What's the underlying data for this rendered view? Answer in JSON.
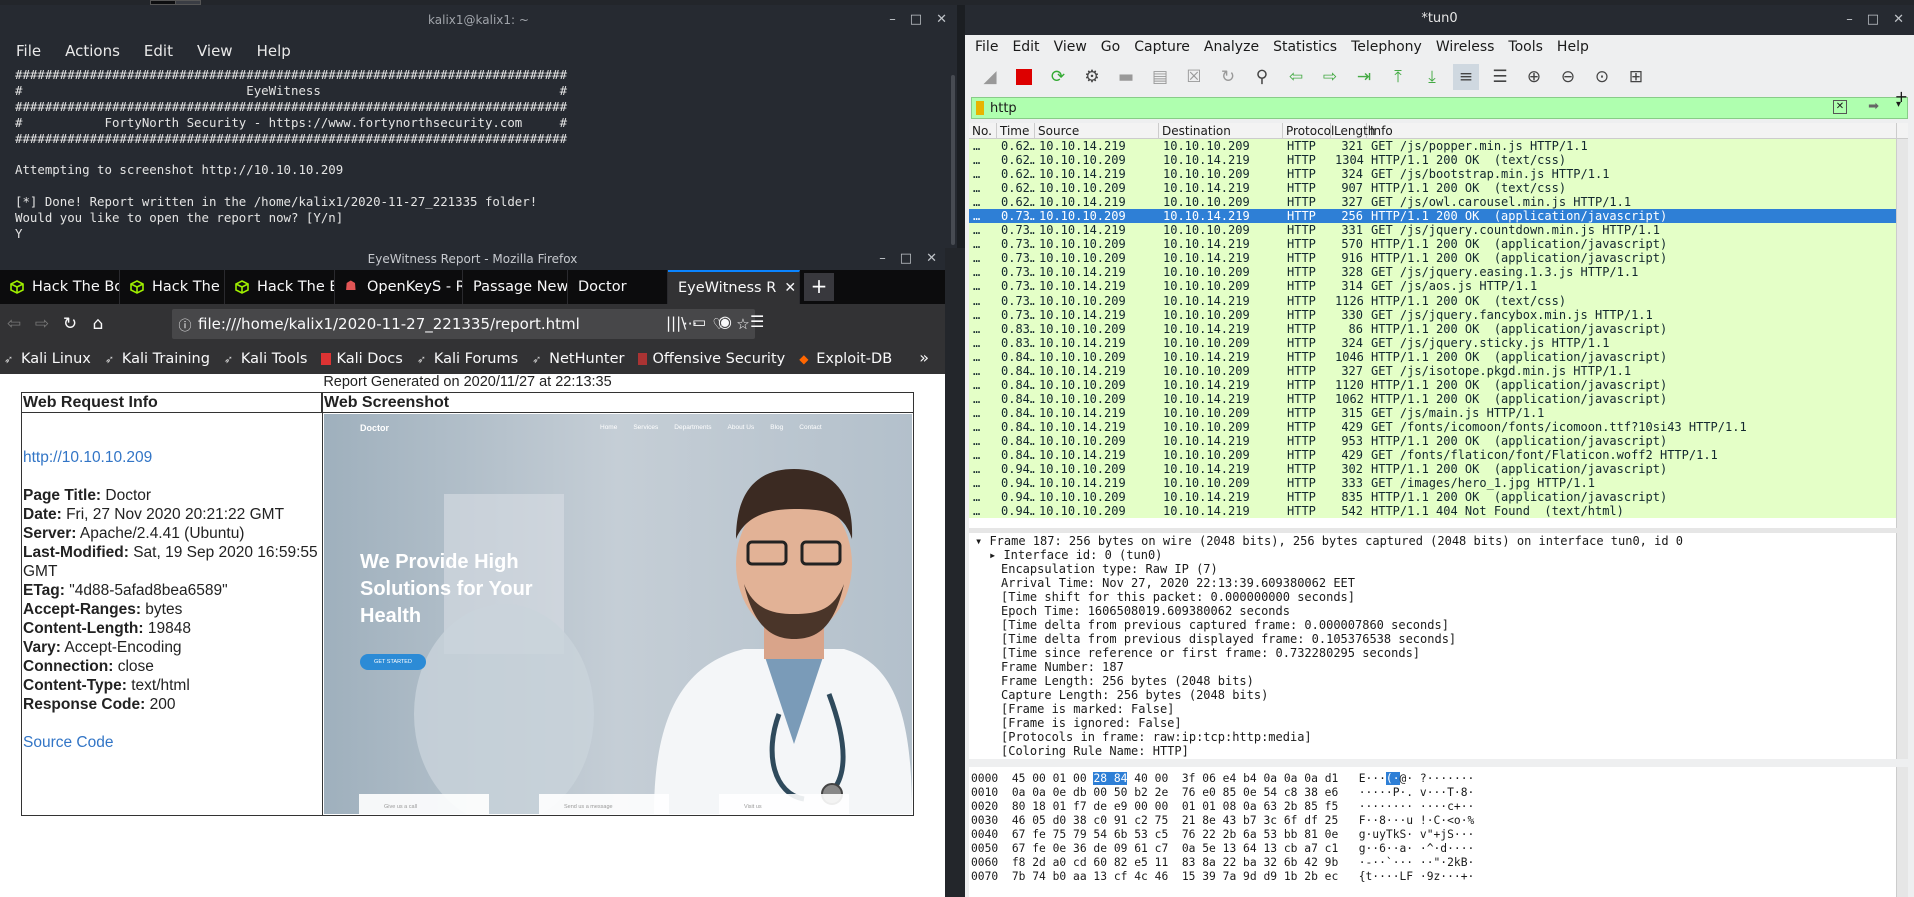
{
  "terminal": {
    "title": "kalix1@kalix1: ~",
    "menu": [
      "File",
      "Actions",
      "Edit",
      "View",
      "Help"
    ],
    "lines": [
      "##########################################################################",
      "#                              EyeWitness                                #",
      "##########################################################################",
      "#           FortyNorth Security - https://www.fortynorthsecurity.com     #",
      "##########################################################################",
      "",
      "Attempting to screenshot http://10.10.10.209",
      "",
      "[*] Done! Report written in the /home/kalix1/2020-11-27_221335 folder!",
      "Would you like to open the report now? [Y/n]",
      "Y"
    ]
  },
  "firefox": {
    "title": "EyeWitness Report - Mozilla Firefox",
    "tabs": [
      {
        "label": "Hack The Box",
        "icon": "htb-cube-icon"
      },
      {
        "label": "Hack The Box",
        "icon": "htb-cube-icon"
      },
      {
        "label": "Hack The Box",
        "icon": "htb-cube-icon"
      },
      {
        "label": "OpenKeyS - R",
        "icon": "bug-icon"
      },
      {
        "label": "Passage News",
        "icon": "none"
      },
      {
        "label": "Doctor",
        "icon": "none"
      },
      {
        "label": "EyeWitness R",
        "icon": "none"
      }
    ],
    "url": "file:///home/kalix1/2020-11-27_221335/report.html",
    "bookmarks": [
      "Kali Linux",
      "Kali Training",
      "Kali Tools",
      "Kali Docs",
      "Kali Forums",
      "NetHunter",
      "Offensive Security",
      "Exploit-DB"
    ]
  },
  "report": {
    "generated": "Report Generated on 2020/11/27 at 22:13:35",
    "col1": "Web Request Info",
    "col2": "Web Screenshot",
    "url": "http://10.10.10.209",
    "fields": [
      {
        "k": "Page Title:",
        "v": " Doctor"
      },
      {
        "k": "Date:",
        "v": " Fri, 27 Nov 2020 20:21:22 GMT"
      },
      {
        "k": "Server:",
        "v": " Apache/2.4.41 (Ubuntu)"
      },
      {
        "k": "Last-Modified:",
        "v": " Sat, 19 Sep 2020 16:59:55 GMT"
      },
      {
        "k": "ETag:",
        "v": " \"4d88-5afad8bea6589\""
      },
      {
        "k": "Accept-Ranges:",
        "v": " bytes"
      },
      {
        "k": "Content-Length:",
        "v": " 19848"
      },
      {
        "k": "Vary:",
        "v": " Accept-Encoding"
      },
      {
        "k": "Connection:",
        "v": " close"
      },
      {
        "k": "Content-Type:",
        "v": " text/html"
      },
      {
        "k": "Response Code:",
        "v": " 200"
      }
    ],
    "source_link": "Source Code",
    "screenshot": {
      "brand": "Doctor",
      "nav": [
        "Home",
        "Services",
        "Departments",
        "About Us",
        "Blog",
        "Contact"
      ],
      "headline": "We Provide High Solutions for Your Health",
      "cta": "GET STARTED",
      "cards": [
        "Give us a call",
        "Send us a message",
        "Visit us"
      ]
    }
  },
  "wireshark": {
    "title": "*tun0",
    "menu": [
      "File",
      "Edit",
      "View",
      "Go",
      "Capture",
      "Analyze",
      "Statistics",
      "Telephony",
      "Wireless",
      "Tools",
      "Help"
    ],
    "filter": "http",
    "columns": [
      "No.",
      "Time",
      "Source",
      "Destination",
      "Protocol",
      "Length",
      "Info"
    ],
    "packets": [
      [
        "…",
        "0.62…",
        "10.10.14.219",
        "10.10.10.209",
        "HTTP",
        "321",
        "GET /js/popper.min.js HTTP/1.1"
      ],
      [
        "…",
        "0.62…",
        "10.10.10.209",
        "10.10.14.219",
        "HTTP",
        "1304",
        "HTTP/1.1 200 OK  (text/css)"
      ],
      [
        "…",
        "0.62…",
        "10.10.14.219",
        "10.10.10.209",
        "HTTP",
        "324",
        "GET /js/bootstrap.min.js HTTP/1.1"
      ],
      [
        "…",
        "0.62…",
        "10.10.10.209",
        "10.10.14.219",
        "HTTP",
        "907",
        "HTTP/1.1 200 OK  (text/css)"
      ],
      [
        "…",
        "0.62…",
        "10.10.14.219",
        "10.10.10.209",
        "HTTP",
        "327",
        "GET /js/owl.carousel.min.js HTTP/1.1"
      ],
      [
        "…",
        "0.73…",
        "10.10.10.209",
        "10.10.14.219",
        "HTTP",
        "256",
        "HTTP/1.1 200 OK  (application/javascript)"
      ],
      [
        "…",
        "0.73…",
        "10.10.14.219",
        "10.10.10.209",
        "HTTP",
        "331",
        "GET /js/jquery.countdown.min.js HTTP/1.1"
      ],
      [
        "…",
        "0.73…",
        "10.10.10.209",
        "10.10.14.219",
        "HTTP",
        "570",
        "HTTP/1.1 200 OK  (application/javascript)"
      ],
      [
        "…",
        "0.73…",
        "10.10.10.209",
        "10.10.14.219",
        "HTTP",
        "916",
        "HTTP/1.1 200 OK  (application/javascript)"
      ],
      [
        "…",
        "0.73…",
        "10.10.14.219",
        "10.10.10.209",
        "HTTP",
        "328",
        "GET /js/jquery.easing.1.3.js HTTP/1.1"
      ],
      [
        "…",
        "0.73…",
        "10.10.14.219",
        "10.10.10.209",
        "HTTP",
        "314",
        "GET /js/aos.js HTTP/1.1"
      ],
      [
        "…",
        "0.73…",
        "10.10.10.209",
        "10.10.14.219",
        "HTTP",
        "1126",
        "HTTP/1.1 200 OK  (text/css)"
      ],
      [
        "…",
        "0.73…",
        "10.10.14.219",
        "10.10.10.209",
        "HTTP",
        "330",
        "GET /js/jquery.fancybox.min.js HTTP/1.1"
      ],
      [
        "…",
        "0.83…",
        "10.10.10.209",
        "10.10.14.219",
        "HTTP",
        "86",
        "HTTP/1.1 200 OK  (application/javascript)"
      ],
      [
        "…",
        "0.83…",
        "10.10.14.219",
        "10.10.10.209",
        "HTTP",
        "324",
        "GET /js/jquery.sticky.js HTTP/1.1"
      ],
      [
        "…",
        "0.84…",
        "10.10.10.209",
        "10.10.14.219",
        "HTTP",
        "1046",
        "HTTP/1.1 200 OK  (application/javascript)"
      ],
      [
        "…",
        "0.84…",
        "10.10.14.219",
        "10.10.10.209",
        "HTTP",
        "327",
        "GET /js/isotope.pkgd.min.js HTTP/1.1"
      ],
      [
        "…",
        "0.84…",
        "10.10.10.209",
        "10.10.14.219",
        "HTTP",
        "1120",
        "HTTP/1.1 200 OK  (application/javascript)"
      ],
      [
        "…",
        "0.84…",
        "10.10.10.209",
        "10.10.14.219",
        "HTTP",
        "1062",
        "HTTP/1.1 200 OK  (application/javascript)"
      ],
      [
        "…",
        "0.84…",
        "10.10.14.219",
        "10.10.10.209",
        "HTTP",
        "315",
        "GET /js/main.js HTTP/1.1"
      ],
      [
        "…",
        "0.84…",
        "10.10.14.219",
        "10.10.10.209",
        "HTTP",
        "429",
        "GET /fonts/icomoon/fonts/icomoon.ttf?10si43 HTTP/1.1"
      ],
      [
        "…",
        "0.84…",
        "10.10.10.209",
        "10.10.14.219",
        "HTTP",
        "953",
        "HTTP/1.1 200 OK  (application/javascript)"
      ],
      [
        "…",
        "0.84…",
        "10.10.14.219",
        "10.10.10.209",
        "HTTP",
        "429",
        "GET /fonts/flaticon/font/Flaticon.woff2 HTTP/1.1"
      ],
      [
        "…",
        "0.94…",
        "10.10.10.209",
        "10.10.14.219",
        "HTTP",
        "302",
        "HTTP/1.1 200 OK  (application/javascript)"
      ],
      [
        "…",
        "0.94…",
        "10.10.14.219",
        "10.10.10.209",
        "HTTP",
        "333",
        "GET /images/hero_1.jpg HTTP/1.1"
      ],
      [
        "…",
        "0.94…",
        "10.10.10.209",
        "10.10.14.219",
        "HTTP",
        "835",
        "HTTP/1.1 200 OK  (application/javascript)"
      ],
      [
        "…",
        "0.94…",
        "10.10.10.209",
        "10.10.14.219",
        "HTTP",
        "542",
        "HTTP/1.1 404 Not Found  (text/html)"
      ]
    ],
    "selected_index": 5,
    "details": [
      "Frame 187: 256 bytes on wire (2048 bits), 256 bytes captured (2048 bits) on interface tun0, id 0",
      "Interface id: 0 (tun0)",
      "Encapsulation type: Raw IP (7)",
      "Arrival Time: Nov 27, 2020 22:13:39.609380062 EET",
      "[Time shift for this packet: 0.000000000 seconds]",
      "Epoch Time: 1606508019.609380062 seconds",
      "[Time delta from previous captured frame: 0.000007860 seconds]",
      "[Time delta from previous displayed frame: 0.105376538 seconds]",
      "[Time since reference or first frame: 0.732280295 seconds]",
      "Frame Number: 187",
      "Frame Length: 256 bytes (2048 bits)",
      "Capture Length: 256 bytes (2048 bits)",
      "[Frame is marked: False]",
      "[Frame is ignored: False]",
      "[Protocols in frame: raw:ip:tcp:http:media]",
      "[Coloring Rule Name: HTTP]"
    ],
    "hex": [
      {
        "off": "0000",
        "pre": "45 00 01 00 ",
        "hl": "28 84",
        "post": " 40 00  3f 06 e4 b4 0a 0a 0a d1",
        "a_pre": "E···",
        "a_hl": "(·",
        "a_post": "@· ?·······"
      },
      {
        "off": "0010",
        "pre": "0a 0a 0e db 00 50 b2 2e  76 e0 85 0e 54 c8 38 e6",
        "hl": "",
        "post": "",
        "a_pre": "·····P·. v···T·8·",
        "a_hl": "",
        "a_post": ""
      },
      {
        "off": "0020",
        "pre": "80 18 01 f7 de e9 00 00  01 01 08 0a 63 2b 85 f5",
        "hl": "",
        "post": "",
        "a_pre": "········ ····c+··",
        "a_hl": "",
        "a_post": ""
      },
      {
        "off": "0030",
        "pre": "46 05 d0 38 c0 91 c2 75  21 8e 43 b7 3c 6f df 25",
        "hl": "",
        "post": "",
        "a_pre": "F··8···u !·C·<o·%",
        "a_hl": "",
        "a_post": ""
      },
      {
        "off": "0040",
        "pre": "67 fe 75 79 54 6b 53 c5  76 22 2b 6a 53 bb 81 0e",
        "hl": "",
        "post": "",
        "a_pre": "g·uyTkS· v\"+jS···",
        "a_hl": "",
        "a_post": ""
      },
      {
        "off": "0050",
        "pre": "67 fe 0e 36 de 09 61 c7  0a 5e 13 64 13 cb a7 c1",
        "hl": "",
        "post": "",
        "a_pre": "g··6··a· ·^·d····",
        "a_hl": "",
        "a_post": ""
      },
      {
        "off": "0060",
        "pre": "f8 2d a0 cd 60 82 e5 11  83 8a 22 ba 32 6b 42 9b",
        "hl": "",
        "post": "",
        "a_pre": "·-··`··· ··\"·2kB·",
        "a_hl": "",
        "a_post": ""
      },
      {
        "off": "0070",
        "pre": "7b 74 b0 aa 13 cf 4c 46  15 39 7a 9d d9 1b 2b ec",
        "hl": "",
        "post": "",
        "a_pre": "{t····LF ·9z···+·",
        "a_hl": "",
        "a_post": ""
      }
    ]
  }
}
